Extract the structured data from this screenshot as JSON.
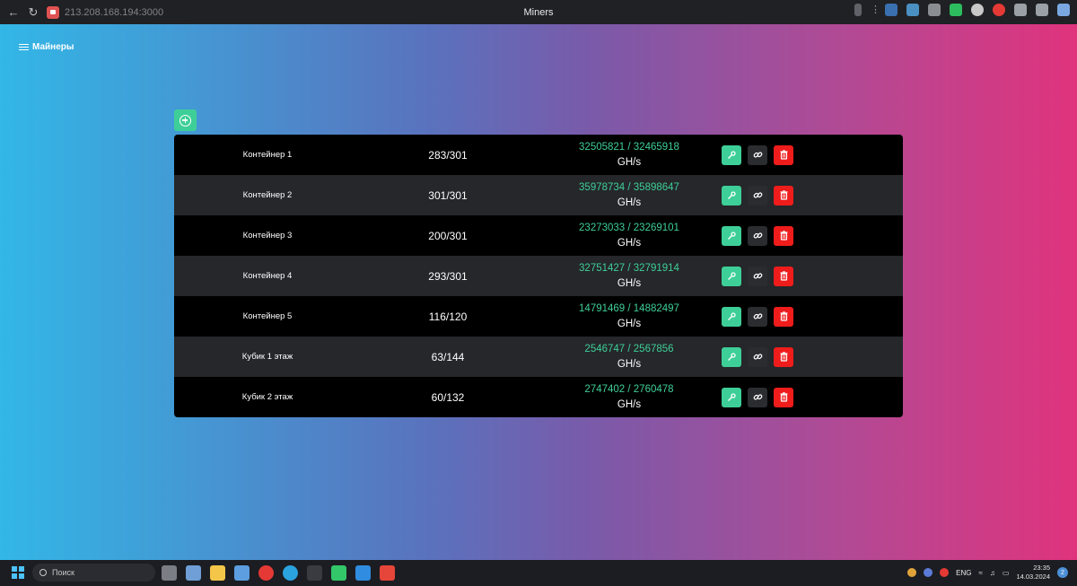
{
  "browser": {
    "url": "213.208.168.194:3000",
    "tab_title": "Miners"
  },
  "app": {
    "brand_label": "Майнеры"
  },
  "miners": [
    {
      "name": "Контейнер 1",
      "count": "283/301",
      "hashrate": "32505821 / 32465918",
      "unit": "GH/s"
    },
    {
      "name": "Контейнер 2",
      "count": "301/301",
      "hashrate": "35978734 / 35898647",
      "unit": "GH/s"
    },
    {
      "name": "Контейнер 3",
      "count": "200/301",
      "hashrate": "23273033 / 23269101",
      "unit": "GH/s"
    },
    {
      "name": "Контейнер 4",
      "count": "293/301",
      "hashrate": "32751427 / 32791914",
      "unit": "GH/s"
    },
    {
      "name": "Контейнер 5",
      "count": "116/120",
      "hashrate": "14791469 / 14882497",
      "unit": "GH/s"
    },
    {
      "name": "Кубик 1 этаж",
      "count": "63/144",
      "hashrate": "2546747 / 2567856",
      "unit": "GH/s"
    },
    {
      "name": "Кубик 2 этаж",
      "count": "60/132",
      "hashrate": "2747402 / 2760478",
      "unit": "GH/s"
    }
  ],
  "taskbar": {
    "search_placeholder": "Поиск",
    "language": "ENG",
    "time": "23:35",
    "date": "14.03.2024",
    "notification_count": "2"
  },
  "colors": {
    "accent_green": "#3ecf98",
    "delete_red": "#ef1c1c",
    "gradient_start": "#32b7e6",
    "gradient_end": "#e0337d"
  }
}
